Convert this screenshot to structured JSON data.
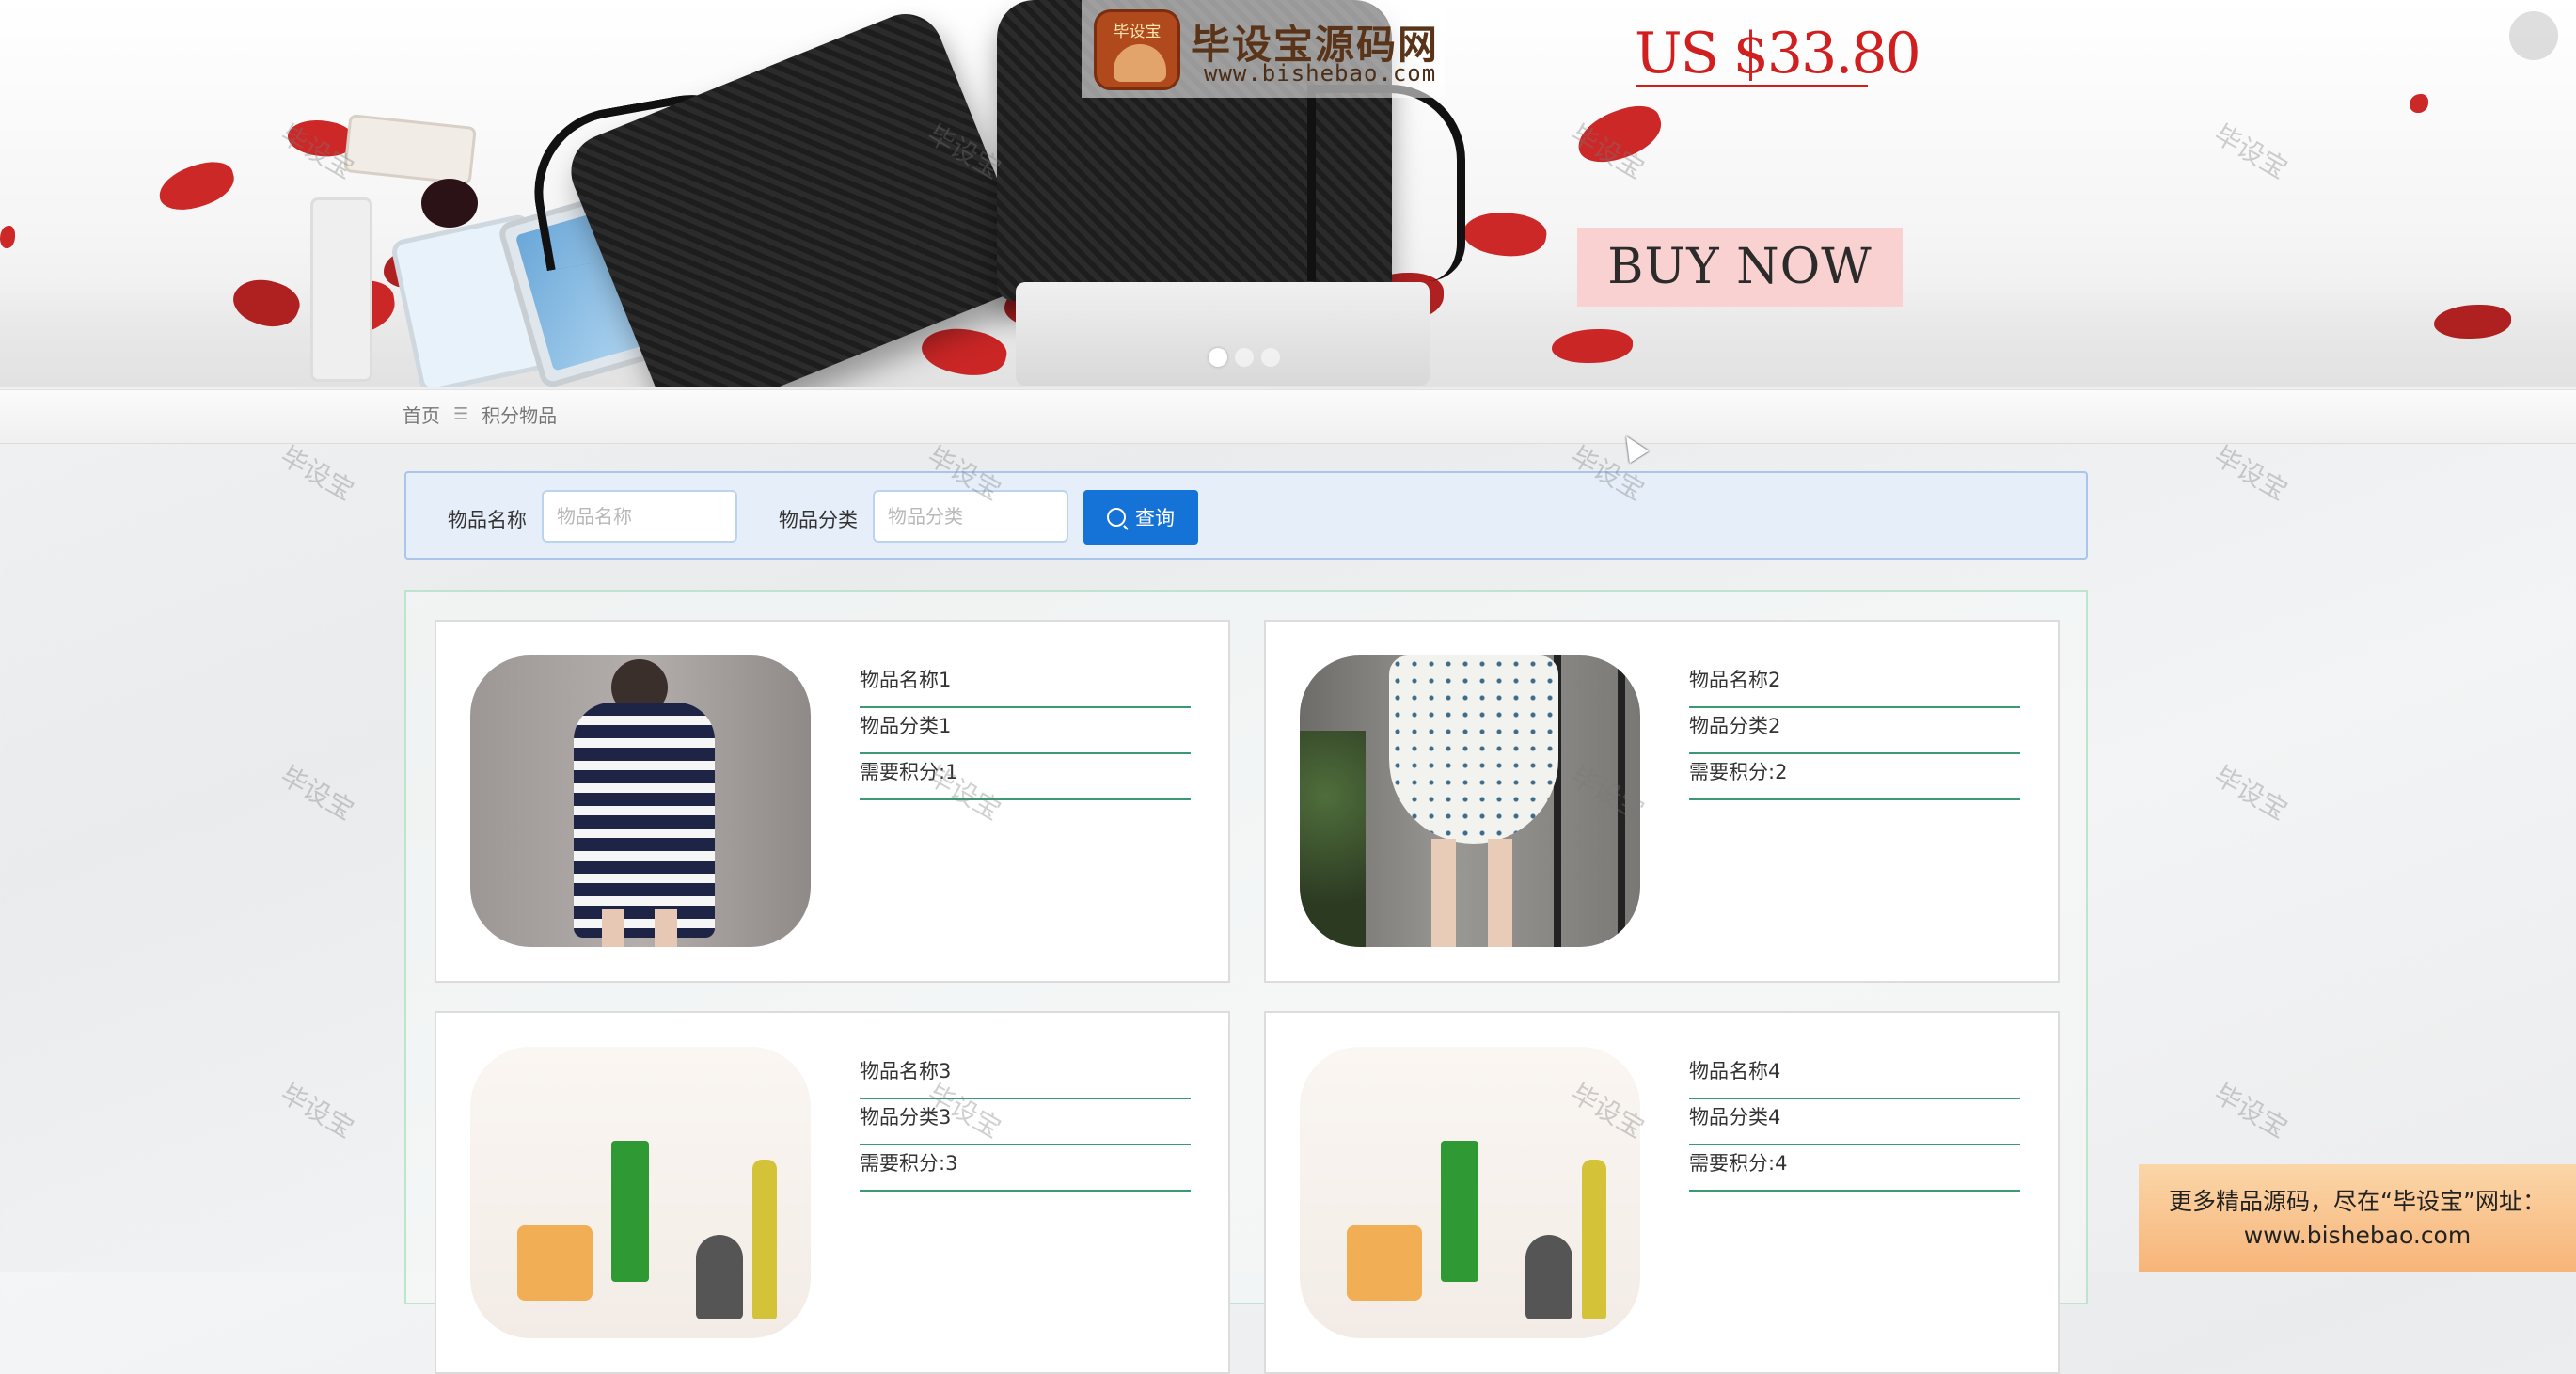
{
  "banner": {
    "price": "US $33.80",
    "buy_now": "BUY NOW",
    "logo_badge": "毕设宝",
    "logo_title": "毕设宝源码网",
    "logo_url": "www.bishebao.com",
    "slide_count": 3,
    "active_slide": 1
  },
  "breadcrumb": {
    "home": "首页",
    "separator": "☰",
    "current": "积分物品"
  },
  "search": {
    "name_label": "物品名称",
    "name_placeholder": "物品名称",
    "category_label": "物品分类",
    "category_placeholder": "物品分类",
    "button_label": "查询"
  },
  "items": [
    {
      "name": "物品名称1",
      "category": "物品分类1",
      "points": "需要积分:1"
    },
    {
      "name": "物品名称2",
      "category": "物品分类2",
      "points": "需要积分:2"
    },
    {
      "name": "物品名称3",
      "category": "物品分类3",
      "points": "需要积分:3"
    },
    {
      "name": "物品名称4",
      "category": "物品分类4",
      "points": "需要积分:4"
    }
  ],
  "watermark": "毕设宝",
  "promo": {
    "line1": "更多精品源码，尽在“毕设宝”网址：",
    "line2": "www.bishebao.com"
  },
  "colors": {
    "accent": "#1572d6",
    "price_red": "#d11f1f",
    "item_divider": "#3a9a73"
  }
}
